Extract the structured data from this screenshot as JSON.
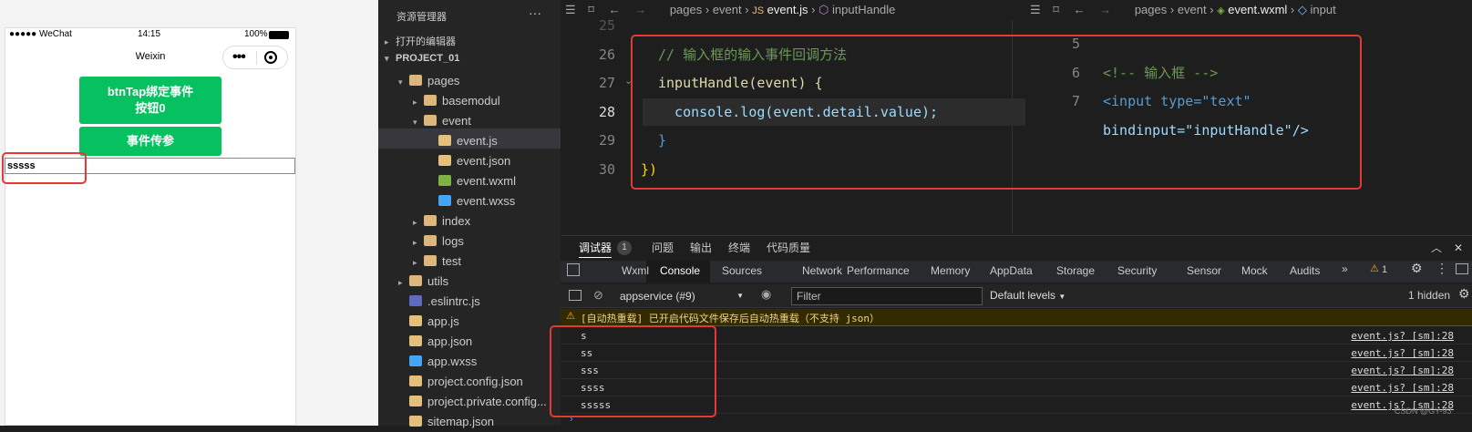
{
  "simulator": {
    "status": {
      "signal": "●●●●● WeChat",
      "time": "14:15",
      "battery": "100%"
    },
    "nav_title": "Weixin",
    "capsule_dots": "•••",
    "button1_line1": "btnTap绑定事件",
    "button1_line2": "按钮0",
    "button2": "事件传参",
    "input_value": "sssss"
  },
  "explorer": {
    "title": "资源管理器",
    "more": "···",
    "open_editors": "打开的编辑器",
    "project": "PROJECT_01",
    "tree": [
      {
        "label": "pages",
        "twisty": "▾",
        "indent": 0,
        "icon": "folder"
      },
      {
        "label": "basemodul",
        "twisty": "▸",
        "indent": 1,
        "icon": "folder"
      },
      {
        "label": "event",
        "twisty": "▾",
        "indent": 1,
        "icon": "folder"
      },
      {
        "label": "event.js",
        "twisty": "",
        "indent": 2,
        "icon": "js"
      },
      {
        "label": "event.json",
        "twisty": "",
        "indent": 2,
        "icon": "json"
      },
      {
        "label": "event.wxml",
        "twisty": "",
        "indent": 2,
        "icon": "wxml"
      },
      {
        "label": "event.wxss",
        "twisty": "",
        "indent": 2,
        "icon": "wxss"
      },
      {
        "label": "index",
        "twisty": "▸",
        "indent": 1,
        "icon": "folder"
      },
      {
        "label": "logs",
        "twisty": "▸",
        "indent": 1,
        "icon": "folder"
      },
      {
        "label": "test",
        "twisty": "▸",
        "indent": 1,
        "icon": "folder"
      },
      {
        "label": "utils",
        "twisty": "▸",
        "indent": 0,
        "icon": "folder"
      },
      {
        "label": ".eslintrc.js",
        "twisty": "",
        "indent": 0,
        "icon": "eslint"
      },
      {
        "label": "app.js",
        "twisty": "",
        "indent": 0,
        "icon": "js"
      },
      {
        "label": "app.json",
        "twisty": "",
        "indent": 0,
        "icon": "json"
      },
      {
        "label": "app.wxss",
        "twisty": "",
        "indent": 0,
        "icon": "wxss"
      },
      {
        "label": "project.config.json",
        "twisty": "",
        "indent": 0,
        "icon": "json"
      },
      {
        "label": "project.private.config...",
        "twisty": "",
        "indent": 0,
        "icon": "json"
      },
      {
        "label": "sitemap.json",
        "twisty": "",
        "indent": 0,
        "icon": "json"
      }
    ]
  },
  "editor_left": {
    "breadcrumb": [
      "pages",
      "event",
      "event.js",
      "inputHandle"
    ],
    "lines": [
      {
        "num": "25",
        "text": ""
      },
      {
        "num": "26",
        "text": "// 输入框的输入事件回调方法"
      },
      {
        "num": "27",
        "text": "inputHandle(event) {"
      },
      {
        "num": "28",
        "text": "  console.log(event.detail.value);"
      },
      {
        "num": "29",
        "text": "}"
      },
      {
        "num": "30",
        "text": "})"
      }
    ]
  },
  "editor_right": {
    "breadcrumb": [
      "pages",
      "event",
      "event.wxml",
      "input"
    ],
    "lines": [
      {
        "num": "5",
        "text": ""
      },
      {
        "num": "6",
        "text": "<!-- 输入框 -->"
      },
      {
        "num": "7",
        "text": "<input type=\"text\""
      },
      {
        "num": "",
        "text": "bindinput=\"inputHandle\"/>"
      }
    ]
  },
  "panel": {
    "tabs": [
      "调试器",
      "问题",
      "输出",
      "终端",
      "代码质量"
    ],
    "debugger_badge": "1",
    "devtools_tabs": [
      "Wxml",
      "Console",
      "Sources",
      "Network",
      "Performance",
      "Memory",
      "AppData",
      "Storage",
      "Security",
      "Sensor",
      "Mock",
      "Audits"
    ],
    "more_tabs": "»",
    "warning_count": "1",
    "context": "appservice (#9)",
    "filter_placeholder": "Filter",
    "levels": "Default levels",
    "hidden": "1 hidden",
    "warning_message": "[自动热重载] 已开启代码文件保存后自动热重载（不支持 json）",
    "logs": [
      {
        "msg": "s",
        "src": "event.js? [sm]:28"
      },
      {
        "msg": "ss",
        "src": "event.js? [sm]:28"
      },
      {
        "msg": "sss",
        "src": "event.js? [sm]:28"
      },
      {
        "msg": "ssss",
        "src": "event.js? [sm]:28"
      },
      {
        "msg": "sssss",
        "src": "event.js? [sm]:28"
      }
    ],
    "watermark": "CSDN @GY-93"
  }
}
